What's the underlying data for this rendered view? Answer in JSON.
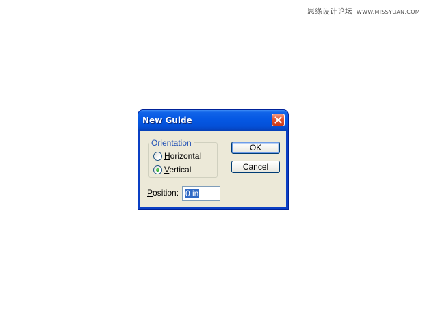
{
  "watermark": {
    "site_name": "思缘设计论坛",
    "url": "WWW.MISSYUAN.COM"
  },
  "dialog": {
    "title": "New Guide",
    "close_icon": "close-x-icon",
    "orientation": {
      "legend": "Orientation",
      "options": [
        {
          "mnemonic": "H",
          "rest": "orizontal",
          "selected": false
        },
        {
          "mnemonic": "V",
          "rest": "ertical",
          "selected": true
        }
      ]
    },
    "ok_label": "OK",
    "cancel_label": "Cancel",
    "position": {
      "mnemonic": "P",
      "rest": "osition:",
      "value": "0 in"
    }
  },
  "colors": {
    "titlebar": "#0558e3",
    "window_face": "#ece9d8",
    "group_legend": "#1f4fb5",
    "selection": "#316ac5",
    "close_button": "#e2522e"
  }
}
